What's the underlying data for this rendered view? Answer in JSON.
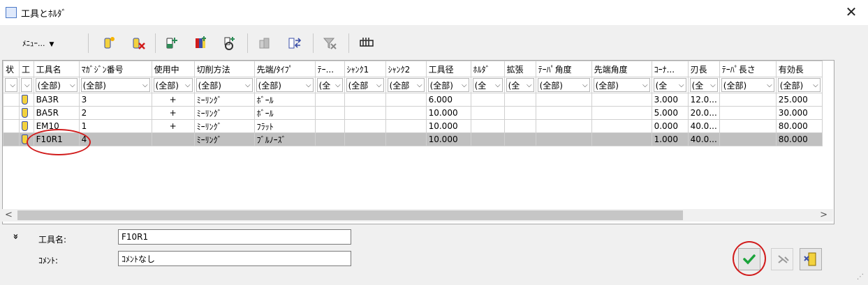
{
  "window": {
    "title": "工具とﾎﾙﾀﾞ",
    "close_glyph": "✕"
  },
  "toolbar": {
    "menu_label": "ﾒﾆｭｰ...",
    "menu_arrow": "▼"
  },
  "columns": [
    "状",
    "工",
    "工具名",
    "ﾏｶﾞｼﾞﾝ番号",
    "使用中",
    "切削方法",
    "先端/ﾀｲﾌﾟ",
    "ﾃｰ...",
    "ｼｬﾝｸ1",
    "ｼｬﾝｸ2",
    "工具径",
    "ﾎﾙﾀﾞ",
    "拡張",
    "ﾃｰﾊﾟ角度",
    "先端角度",
    "ｺｰﾅ...",
    "刃長",
    "ﾃｰﾊﾟ長さ",
    "有効長"
  ],
  "filters": [
    "",
    "",
    "(全部)",
    "(全部)",
    "(全部)",
    "(全部)",
    "(全部)",
    "(全",
    "(全部",
    "(全部",
    "(全部)",
    "(全",
    "(全",
    "(全部)",
    "(全部)",
    "(全",
    "(全",
    "(全部)",
    "(全部)"
  ],
  "rows": [
    {
      "name": "BA3R",
      "mag": "3",
      "used": "+",
      "method": "ﾐｰﾘﾝｸﾞ",
      "tip": "ﾎﾞｰﾙ",
      "dia": "6.000",
      "corner": "3.000",
      "flute": "12.0...",
      "eff": "25.000"
    },
    {
      "name": "BA5R",
      "mag": "2",
      "used": "+",
      "method": "ﾐｰﾘﾝｸﾞ",
      "tip": "ﾎﾞｰﾙ",
      "dia": "10.000",
      "corner": "5.000",
      "flute": "20.0...",
      "eff": "30.000"
    },
    {
      "name": "EM10",
      "mag": "1",
      "used": "+",
      "method": "ﾐｰﾘﾝｸﾞ",
      "tip": "ﾌﾗｯﾄ",
      "dia": "10.000",
      "corner": "0.000",
      "flute": "40.0...",
      "eff": "80.000"
    },
    {
      "name": "F10R1",
      "mag": "4",
      "used": "",
      "method": "ﾐｰﾘﾝｸﾞ",
      "tip": "ﾌﾞﾙﾉｰｽﾞ",
      "dia": "10.000",
      "corner": "1.000",
      "flute": "40.0...",
      "eff": "80.000"
    }
  ],
  "scroll": {
    "left": "<",
    "right": ">"
  },
  "details": {
    "expander": "»",
    "tool_name_label": "工具名:",
    "tool_name_value": "F10R1",
    "comment_label": "ｺﾒﾝﾄ:",
    "comment_value": "ｺﾒﾝﾄなし"
  },
  "colors": {
    "highlight": "#d11c1c",
    "ok_check": "#1aa33a",
    "selected_row": "#c0c0c0"
  }
}
